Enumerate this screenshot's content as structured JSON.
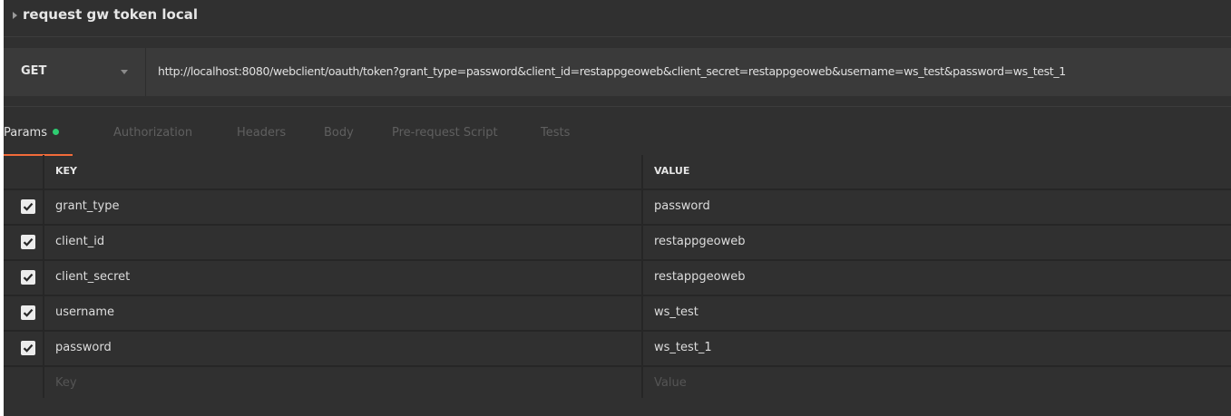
{
  "request": {
    "title": "request gw token local"
  },
  "url_bar": {
    "method": "GET",
    "url": "http://localhost:8080/webclient/oauth/token?grant_type=password&client_id=restappgeoweb&client_secret=restappgeoweb&username=ws_test&password=ws_test_1"
  },
  "tabs": [
    {
      "label": "Params",
      "active": true
    },
    {
      "label": "Authorization",
      "active": false
    },
    {
      "label": "Headers",
      "active": false
    },
    {
      "label": "Body",
      "active": false
    },
    {
      "label": "Pre-request Script",
      "active": false
    },
    {
      "label": "Tests",
      "active": false
    }
  ],
  "params_table": {
    "headers": {
      "key": "KEY",
      "value": "VALUE"
    },
    "rows": [
      {
        "key": "grant_type",
        "value": "password",
        "checked": true
      },
      {
        "key": "client_id",
        "value": "restappgeoweb",
        "checked": true
      },
      {
        "key": "client_secret",
        "value": "restappgeoweb",
        "checked": true
      },
      {
        "key": "username",
        "value": "ws_test",
        "checked": true
      },
      {
        "key": "password",
        "value": "ws_test_1",
        "checked": true
      }
    ],
    "placeholder": {
      "key": "Key",
      "value": "Value"
    }
  },
  "colors": {
    "background": "#303030",
    "accent_underline": "#f26b3a",
    "params_indicator": "#2ecc71"
  }
}
